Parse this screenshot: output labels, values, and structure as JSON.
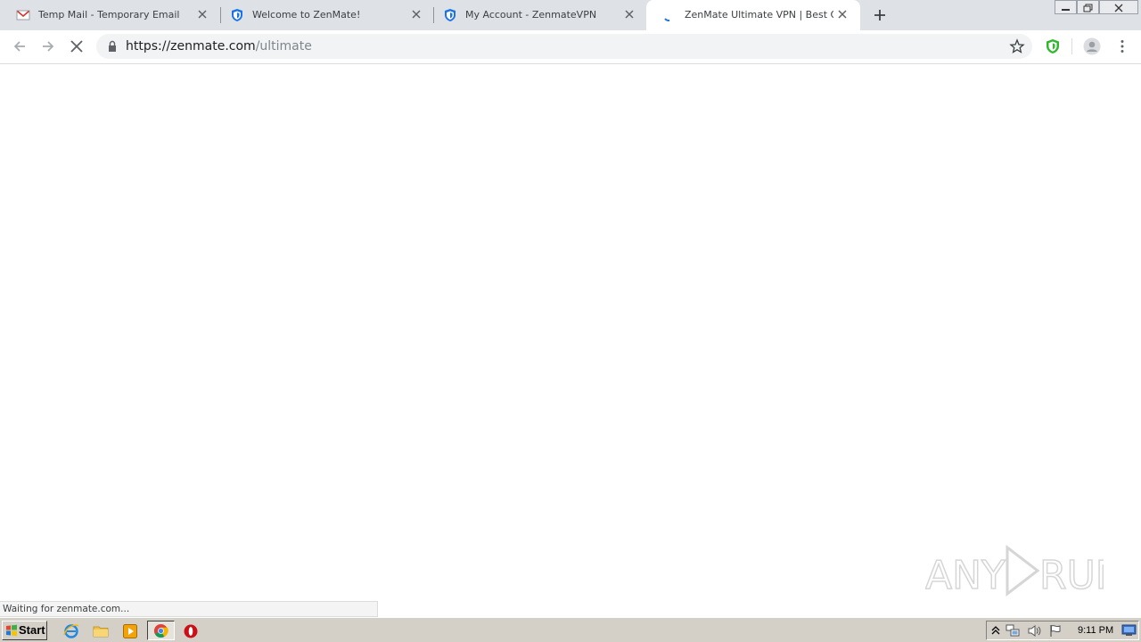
{
  "tabs": [
    {
      "title": "Temp Mail - Temporary Email",
      "icon": "gmail-envelope-icon"
    },
    {
      "title": "Welcome to ZenMate!",
      "icon": "zenmate-shield-icon"
    },
    {
      "title": "My Account - ZenmateVPN",
      "icon": "zenmate-shield-icon"
    },
    {
      "title": "ZenMate Ultimate VPN | Best Online ",
      "icon": "loading-spinner-icon",
      "active": true
    }
  ],
  "address_bar": {
    "host": "https://zenmate.com",
    "path": "/ultimate"
  },
  "status_bar": {
    "text": "Waiting for zenmate.com..."
  },
  "watermark": {
    "text": "ANY RUN"
  },
  "taskbar": {
    "start_label": "Start",
    "clock": "9:11 PM"
  },
  "colors": {
    "tabstrip_bg": "#dee1e6",
    "omnibox_bg": "#f1f3f4",
    "zenmate_blue": "#1a73e8",
    "zenmate_green": "#2eb82e",
    "taskbar_bg": "#d4d0c8"
  }
}
